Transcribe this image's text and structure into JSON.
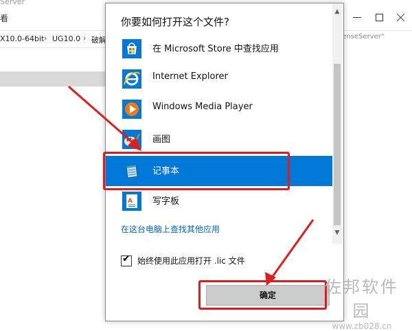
{
  "explorer": {
    "title_fragment": "Server",
    "ribbon_label": "看",
    "breadcrumbs": [
      "X10.0-64bit",
      "UG10.0",
      "破解"
    ],
    "search_placeholder": "icenseServer\""
  },
  "dialog": {
    "title": "你要如何打开这个文件?",
    "apps": [
      {
        "label": "在 Microsoft Store 中查找应用",
        "icon": "store-icon",
        "selected": false
      },
      {
        "label": "Internet Explorer",
        "icon": "internet-explorer-icon",
        "selected": false
      },
      {
        "label": "Windows Media Player",
        "icon": "media-player-icon",
        "selected": false
      },
      {
        "label": "画图",
        "icon": "paint-icon",
        "selected": false
      },
      {
        "label": "记事本",
        "icon": "notepad-icon",
        "selected": true
      },
      {
        "label": "写字板",
        "icon": "wordpad-icon",
        "selected": false
      }
    ],
    "more_apps_link": "在这台电脑上查找其他应用",
    "always_use_label": "始终使用此应用打开 .lic 文件",
    "always_use_checked": true,
    "ok_label": "确定"
  },
  "watermark": {
    "logo_text": "佐邦软件园",
    "url": "www.zb028.cn"
  },
  "colors": {
    "selection": "#0078d7",
    "annotation": "#e21b1b",
    "link": "#0066cc"
  }
}
